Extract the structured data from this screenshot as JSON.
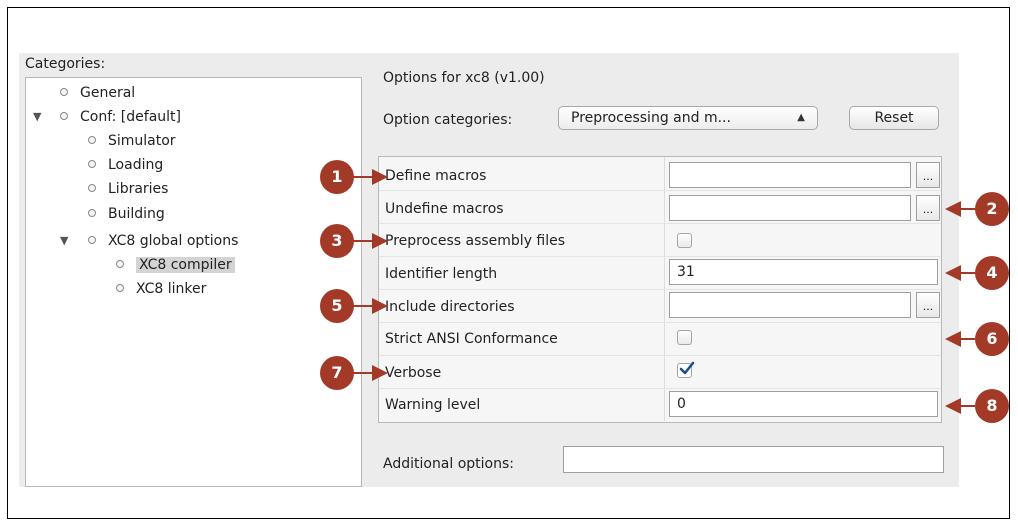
{
  "categories": {
    "label": "Categories:",
    "items": [
      {
        "label": "General"
      },
      {
        "label": "Conf: [default]"
      },
      {
        "label": "Simulator"
      },
      {
        "label": "Loading"
      },
      {
        "label": "Libraries"
      },
      {
        "label": "Building"
      },
      {
        "label": "XC8 global options"
      },
      {
        "label": "XC8 compiler"
      },
      {
        "label": "XC8 linker"
      }
    ],
    "selected": "XC8 compiler"
  },
  "options": {
    "title": "Options for xc8 (v1.00)",
    "category_label": "Option categories:",
    "category_value": "Preprocessing and m...",
    "reset_label": "Reset",
    "rows": [
      {
        "label": "Define macros",
        "value": ""
      },
      {
        "label": "Undefine macros",
        "value": ""
      },
      {
        "label": "Preprocess assembly files",
        "checked": false
      },
      {
        "label": "Identifier length",
        "value": "31"
      },
      {
        "label": "Include directories",
        "value": ""
      },
      {
        "label": "Strict ANSI Conformance",
        "checked": false
      },
      {
        "label": "Verbose",
        "checked": true
      },
      {
        "label": "Warning level",
        "value": "0"
      }
    ],
    "browse_label": "...",
    "additional_label": "Additional options:",
    "additional_value": ""
  },
  "callouts": [
    "1",
    "2",
    "3",
    "4",
    "5",
    "6",
    "7",
    "8"
  ],
  "colors": {
    "callout": "#a33a28",
    "selected": "#d4d4d4",
    "check": "#1e4f8c"
  }
}
